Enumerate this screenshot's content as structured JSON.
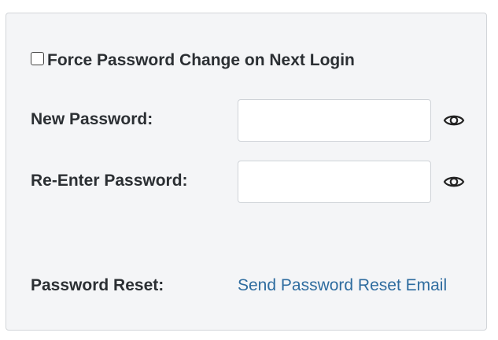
{
  "force_change": {
    "label": "Force Password Change on Next Login",
    "checked": false
  },
  "new_password": {
    "label": "New Password:",
    "value": ""
  },
  "reenter_password": {
    "label": "Re-Enter Password:",
    "value": ""
  },
  "password_reset": {
    "label": "Password Reset:",
    "link_text": "Send Password Reset Email"
  },
  "icons": {
    "show_password": "eye-icon"
  },
  "colors": {
    "panel_background": "#f4f5f7",
    "link": "#2e6c9f",
    "text": "#2b2f33"
  }
}
